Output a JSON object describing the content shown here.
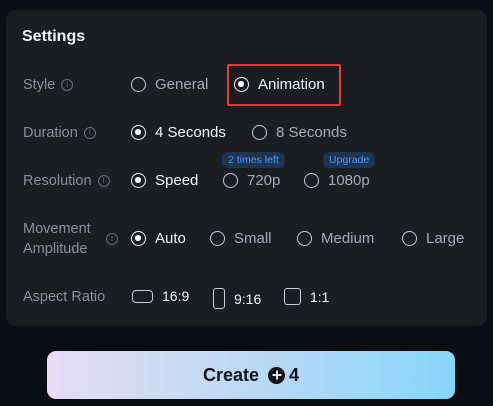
{
  "settings": {
    "title": "Settings",
    "style": {
      "label": "Style",
      "info": "i",
      "options": [
        "General",
        "Animation"
      ],
      "selected": "Animation"
    },
    "duration": {
      "label": "Duration",
      "info": "i",
      "options": [
        "4 Seconds",
        "8 Seconds"
      ],
      "selected": "4 Seconds"
    },
    "resolution": {
      "label": "Resolution",
      "info": "i",
      "options": [
        "Speed",
        "720p",
        "1080p"
      ],
      "selected": "Speed",
      "badges": {
        "p720": "2 times left",
        "p1080": "Upgrade"
      }
    },
    "movement": {
      "label": "Movement Amplitude",
      "info": "i",
      "options": [
        "Auto",
        "Small",
        "Medium",
        "Large"
      ],
      "selected": "Auto"
    },
    "aspect_ratio": {
      "label": "Aspect Ratio",
      "options": [
        "16:9",
        "9:16",
        "1:1"
      ]
    }
  },
  "create_button": {
    "label": "Create",
    "cost": "4"
  },
  "colors": {
    "panel_bg": "#1c1d21",
    "page_bg": "#0b0d12",
    "highlight_border": "#e43b3b",
    "badge_text": "#4d9bff"
  }
}
